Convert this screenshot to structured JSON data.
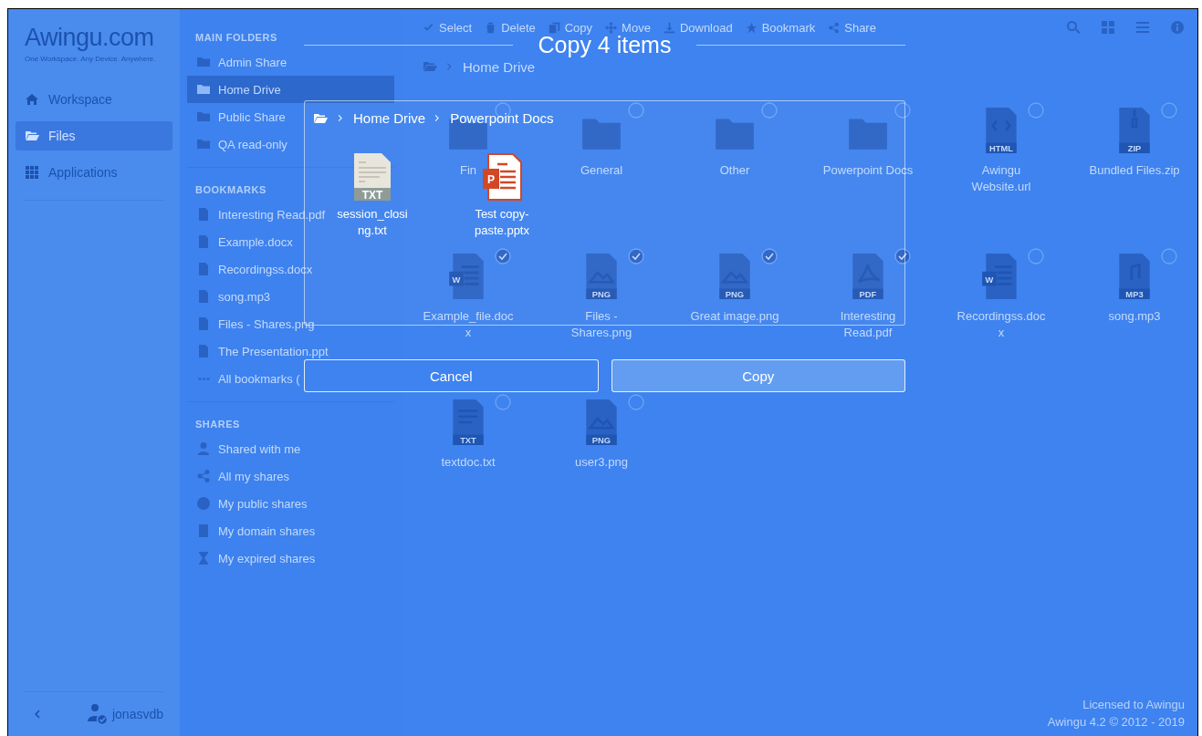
{
  "sidebar": {
    "logo": "Awingu.com",
    "tagline": "One Workspace. Any Device. Anywhere.",
    "nav": [
      {
        "label": "Workspace",
        "selected": false
      },
      {
        "label": "Files",
        "selected": true
      },
      {
        "label": "Applications",
        "selected": false
      }
    ],
    "user": {
      "name": "jonasvdb"
    }
  },
  "folder_panel": {
    "sections": [
      {
        "heading": "MAIN FOLDERS",
        "items": [
          {
            "label": "Admin Share",
            "selected": false
          },
          {
            "label": "Home Drive",
            "selected": true
          },
          {
            "label": "Public Share",
            "selected": false
          },
          {
            "label": "QA read-only",
            "selected": false
          }
        ]
      },
      {
        "heading": "BOOKMARKS",
        "items": [
          {
            "label": "Interesting Read.pdf",
            "selected": false
          },
          {
            "label": "Example.docx",
            "selected": false
          },
          {
            "label": "Recordingss.docx",
            "selected": false
          },
          {
            "label": "song.mp3",
            "selected": false
          },
          {
            "label": "Files - Shares.png",
            "selected": false
          },
          {
            "label": "The Presentation.ppt",
            "selected": false
          },
          {
            "label": "All bookmarks (",
            "selected": false
          }
        ]
      },
      {
        "heading": "SHARES",
        "items": [
          {
            "label": "Shared with me",
            "selected": false
          },
          {
            "label": "All my shares",
            "selected": false
          },
          {
            "label": "My public shares",
            "selected": false
          },
          {
            "label": "My domain shares",
            "selected": false
          },
          {
            "label": "My expired shares",
            "selected": false
          }
        ]
      }
    ]
  },
  "toolbar": {
    "actions": [
      "Select",
      "Delete",
      "Copy",
      "Move",
      "Download",
      "Bookmark",
      "Share"
    ]
  },
  "breadcrumb": [
    "Home Drive"
  ],
  "files": [
    {
      "name": "Fin",
      "kind": "folder",
      "selected": false
    },
    {
      "name": "General",
      "kind": "folder",
      "selected": false
    },
    {
      "name": "Other",
      "kind": "folder",
      "selected": false
    },
    {
      "name": "Powerpoint Docs",
      "kind": "folder",
      "selected": false
    },
    {
      "name": "Awingu Website.url",
      "kind": "web",
      "badge": "HTML",
      "selected": false
    },
    {
      "name": "Bundled Files.zip",
      "kind": "archive",
      "badge": "ZIP",
      "selected": false
    },
    {
      "name": "Example_file.docx",
      "kind": "word",
      "letter": "W",
      "selected": true
    },
    {
      "name": "Files - Shares.png",
      "kind": "image",
      "badge": "PNG",
      "selected": true
    },
    {
      "name": "Great image.png",
      "kind": "image",
      "badge": "PNG",
      "selected": true
    },
    {
      "name": "Interesting Read.pdf",
      "kind": "pdf",
      "badge": "PDF",
      "selected": true
    },
    {
      "name": "Recordingss.docx",
      "kind": "word",
      "letter": "W",
      "selected": false
    },
    {
      "name": "song.mp3",
      "kind": "audio",
      "badge": "MP3",
      "selected": false
    },
    {
      "name": "textdoc.txt",
      "kind": "text",
      "badge": "TXT",
      "selected": false
    },
    {
      "name": "user3.png",
      "kind": "image",
      "badge": "PNG",
      "selected": false
    }
  ],
  "footer": {
    "license": "Licensed to Awingu",
    "version": "Awingu 4.2 © 2012 - 2019"
  },
  "dialog": {
    "title": "Copy 4 items",
    "breadcrumb": [
      "Home Drive",
      "Powerpoint Docs"
    ],
    "files": [
      {
        "name": "session_closing.txt",
        "kind": "text",
        "badge": "TXT"
      },
      {
        "name": "Test copy-paste.pptx",
        "kind": "slides",
        "letter": "P"
      }
    ],
    "buttons": [
      {
        "label": "Cancel",
        "kind": "secondary"
      },
      {
        "label": "Copy",
        "kind": "primary"
      }
    ]
  }
}
